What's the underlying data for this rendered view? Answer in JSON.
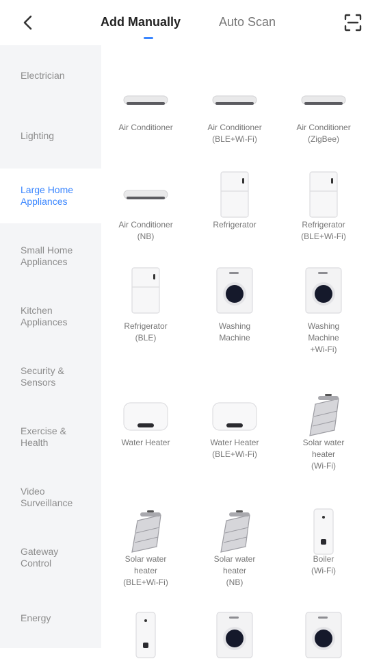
{
  "header": {
    "tabs": [
      {
        "label": "Add Manually"
      },
      {
        "label": "Auto Scan"
      }
    ]
  },
  "sidebar": {
    "items": [
      {
        "label": "Electrician"
      },
      {
        "label": "Lighting"
      },
      {
        "label": "Large Home\nAppliances"
      },
      {
        "label": "Small Home\nAppliances"
      },
      {
        "label": "Kitchen\nAppliances"
      },
      {
        "label": "Security &\nSensors"
      },
      {
        "label": "Exercise &\nHealth"
      },
      {
        "label": "Video\nSurveillance"
      },
      {
        "label": "Gateway\nControl"
      },
      {
        "label": "Energy"
      }
    ]
  },
  "devices": [
    {
      "label": "Air Conditioner",
      "icon": "air-conditioner-icon"
    },
    {
      "label": "Air Conditioner\n(BLE+Wi-Fi)",
      "icon": "air-conditioner-icon"
    },
    {
      "label": "Air Conditioner\n(ZigBee)",
      "icon": "air-conditioner-icon"
    },
    {
      "label": "Air Conditioner\n(NB)",
      "icon": "air-conditioner-icon"
    },
    {
      "label": "Refrigerator",
      "icon": "refrigerator-icon"
    },
    {
      "label": "Refrigerator\n(BLE+Wi-Fi)",
      "icon": "refrigerator-icon"
    },
    {
      "label": "Refrigerator\n(BLE)",
      "icon": "refrigerator-icon"
    },
    {
      "label": "Washing\nMachine",
      "icon": "washing-machine-icon"
    },
    {
      "label": "Washing\nMachine\n+Wi-Fi)",
      "icon": "washing-machine-icon"
    },
    {
      "label": "Water Heater",
      "icon": "water-heater-icon"
    },
    {
      "label": "Water Heater\n(BLE+Wi-Fi)",
      "icon": "water-heater-icon"
    },
    {
      "label": "Solar water\nheater\n(Wi-Fi)",
      "icon": "solar-water-heater-icon"
    },
    {
      "label": "Solar water\nheater\n(BLE+Wi-Fi)",
      "icon": "solar-water-heater-icon"
    },
    {
      "label": "Solar water\nheater\n(NB)",
      "icon": "solar-water-heater-icon"
    },
    {
      "label": "Boiler\n(Wi-Fi)",
      "icon": "boiler-icon"
    }
  ],
  "colors": {
    "accent": "#3a86ff",
    "sidebar_bg": "#f4f5f7"
  }
}
